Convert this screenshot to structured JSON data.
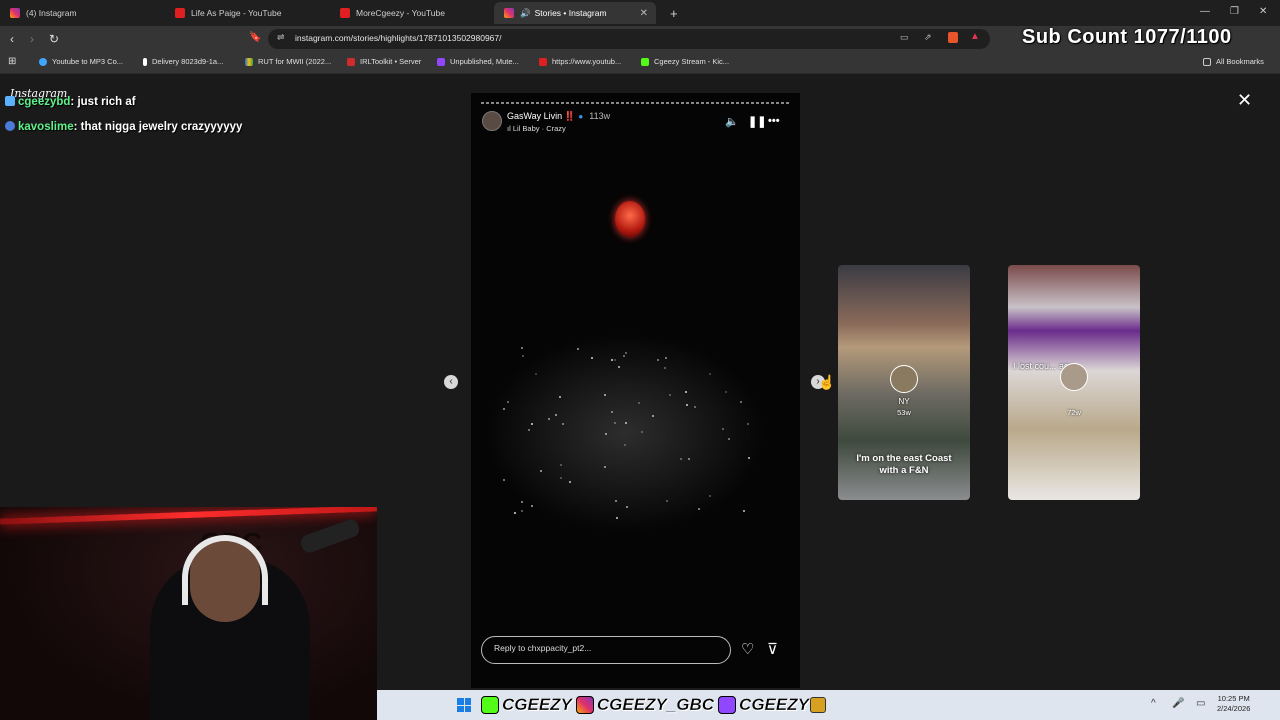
{
  "browser": {
    "tabs": [
      {
        "title": "(4) Instagram",
        "favicon": "instagram-icon"
      },
      {
        "title": "Life As Paige - YouTube",
        "favicon": "youtube-icon"
      },
      {
        "title": "MoreCgeezy - YouTube",
        "favicon": "youtube-icon"
      },
      {
        "title": "Stories • Instagram",
        "favicon": "instagram-icon",
        "active": true
      }
    ],
    "url": "instagram.com/stories/highlights/17871013502980967/",
    "bookmarks": [
      "Youtube to MP3 Co...",
      "Delivery 8023d9-1a...",
      "RUT for MWII (2022...",
      "IRLToolkit • Server",
      "Unpublished, Mute...",
      "https://www.youtub...",
      "Cgeezy Stream - Kic..."
    ],
    "all_bookmarks": "All Bookmarks"
  },
  "overlay": {
    "sub_count": "Sub Count 1077/1100",
    "chat": [
      {
        "user": "cgeezybd",
        "message": "just rich af"
      },
      {
        "user": "kavoslime",
        "message": "that nigga jewelry crazyyyyyy"
      }
    ],
    "watermark": "Instagram"
  },
  "story": {
    "author": "GasWay Livin",
    "author_badge": "‼️",
    "age": "113w",
    "song": "Lil Baby · Crazy",
    "reply_placeholder": "Reply to chxppacity_pt2..."
  },
  "previews": [
    {
      "title": "NY",
      "age": "53w",
      "caption": "I'm on the east Coast with a F&N"
    },
    {
      "title": "",
      "age": "72w",
      "caption": "I lost cou... ago"
    }
  ],
  "taskbar": {
    "banner": [
      "CGEEZY",
      "CGEEZY_GBC",
      "CGEEZY"
    ],
    "time": "10:25 PM",
    "date": "2/24/2026"
  },
  "colors": {
    "chat_user": "#5ff08a",
    "led": "#ff2c2c",
    "kick": "#53fc18",
    "twitch": "#9146ff"
  }
}
